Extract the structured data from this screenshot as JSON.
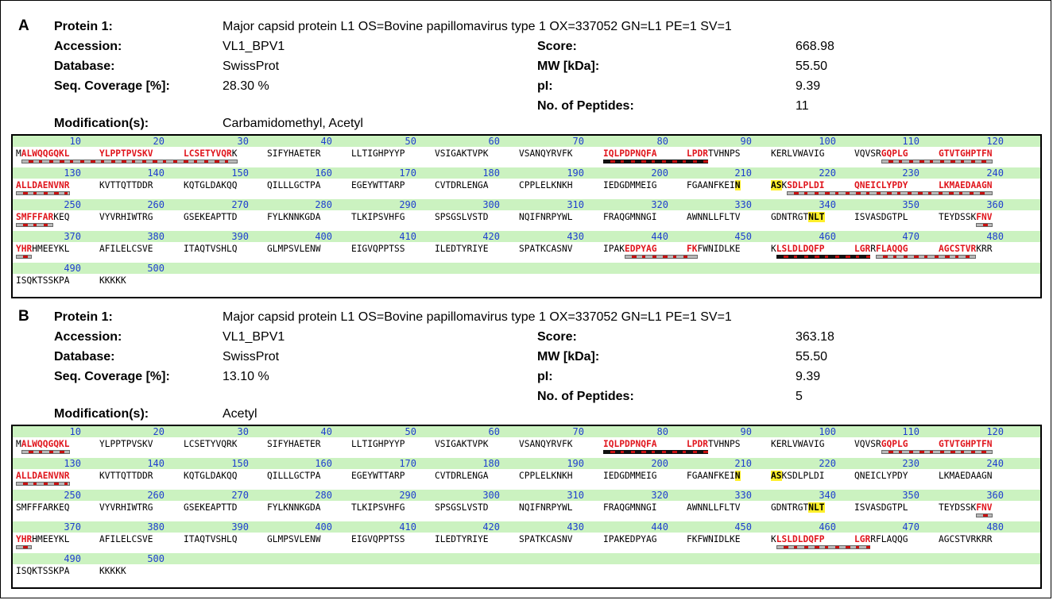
{
  "panels": [
    {
      "letter": "A",
      "protein_label": "Protein 1:",
      "protein_value": "Major capsid protein L1 OS=Bovine papillomavirus type 1 OX=337052 GN=L1 PE=1 SV=1",
      "accession_label": "Accession:",
      "accession_value": "VL1_BPV1",
      "database_label": "Database:",
      "database_value": "SwissProt",
      "coverage_label": "Seq. Coverage [%]:",
      "coverage_value": "28.30 %",
      "score_label": "Score:",
      "score_value": "668.98",
      "mw_label": "MW [kDa]:",
      "mw_value": "55.50",
      "pi_label": "pI:",
      "pi_value": "9.39",
      "peptides_label": "No. of Peptides:",
      "peptides_value": "11",
      "modification_label": "Modification(s):",
      "modification_value": "Carbamidomethyl, Acetyl"
    },
    {
      "letter": "B",
      "protein_label": "Protein 1:",
      "protein_value": "Major capsid protein L1 OS=Bovine papillomavirus type 1 OX=337052 GN=L1 PE=1 SV=1",
      "accession_label": "Accession:",
      "accession_value": "VL1_BPV1",
      "database_label": "Database:",
      "database_value": "SwissProt",
      "coverage_label": "Seq. Coverage [%]:",
      "coverage_value": "13.10 %",
      "score_label": "Score:",
      "score_value": "363.18",
      "mw_label": "MW [kDa]:",
      "mw_value": "55.50",
      "pi_label": "pI:",
      "pi_value": "9.39",
      "peptides_label": "No. of Peptides:",
      "peptides_value": "5",
      "modification_label": "Modification(s):",
      "modification_value": "Acetyl"
    }
  ],
  "sequence_rows": [
    {
      "numbers": [
        "10",
        "20",
        "30",
        "40",
        "50",
        "60",
        "70",
        "80",
        "90",
        "100",
        "110",
        "120"
      ],
      "blocks": [
        "MALWQQGQKL",
        "YLPPTPVSKV",
        "LCSETYVQRK",
        "SIFYHAETER",
        "LLTIGHPYYP",
        "VSIGAKTVPK",
        "VSANQYRVFK",
        "IQLPDPNQFA",
        "LPDRTVHNPS",
        "KERLVWAVIG",
        "VQVSRGQPLG",
        "GTVTGHPTFN"
      ]
    },
    {
      "numbers": [
        "130",
        "140",
        "150",
        "160",
        "170",
        "180",
        "190",
        "200",
        "210",
        "220",
        "230",
        "240"
      ],
      "blocks": [
        "ALLDAENVNR",
        "KVTTQTTDDR",
        "KQTGLDAKQQ",
        "QILLLGCTPA",
        "EGEYWTTARP",
        "CVTDRLENGA",
        "CPPLELKNKH",
        "IEDGDMMEIG",
        "FGAANFKEIN",
        "ASKSDLPLDI",
        "QNEICLYPDY",
        "LKMAEDAAGN"
      ]
    },
    {
      "numbers": [
        "250",
        "260",
        "270",
        "280",
        "290",
        "300",
        "310",
        "320",
        "330",
        "340",
        "350",
        "360"
      ],
      "blocks": [
        "SMFFFARKEQ",
        "VYVRHIWTRG",
        "GSEKEAPTTD",
        "FYLKNNKGDA",
        "TLKIPSVHFG",
        "SPSGSLVSTD",
        "NQIFNRPYWL",
        "FRAQGMNNGI",
        "AWNNLLFLTV",
        "GDNTRGTNLT",
        "ISVASDGTPL",
        "TEYDSSKFNV"
      ]
    },
    {
      "numbers": [
        "370",
        "380",
        "390",
        "400",
        "410",
        "420",
        "430",
        "440",
        "450",
        "460",
        "470",
        "480"
      ],
      "blocks": [
        "YHRHMEEYKL",
        "AFILELCSVE",
        "ITAQTVSHLQ",
        "GLMPSVLENW",
        "EIGVQPPTSS",
        "ILEDTYRIYE",
        "SPATKCASNV",
        "IPAKEDPYAG",
        "FKFWNIDLKE",
        "KLSLDLDQFP",
        "LGRRFLAQQG",
        "AGCSTVRKRR"
      ]
    },
    {
      "numbers": [
        "490",
        "500"
      ],
      "blocks": [
        "ISQKTSSKPA",
        "KKKKK"
      ]
    }
  ],
  "colors": {
    "number_band": "#cbf2c0",
    "number_text": "#1f3fcf",
    "covered_residue": "#e0151c",
    "glyco_highlight": "#ffef2a",
    "coverage_bar": "#b9b9b9",
    "coverage_mark": "#c81010"
  }
}
